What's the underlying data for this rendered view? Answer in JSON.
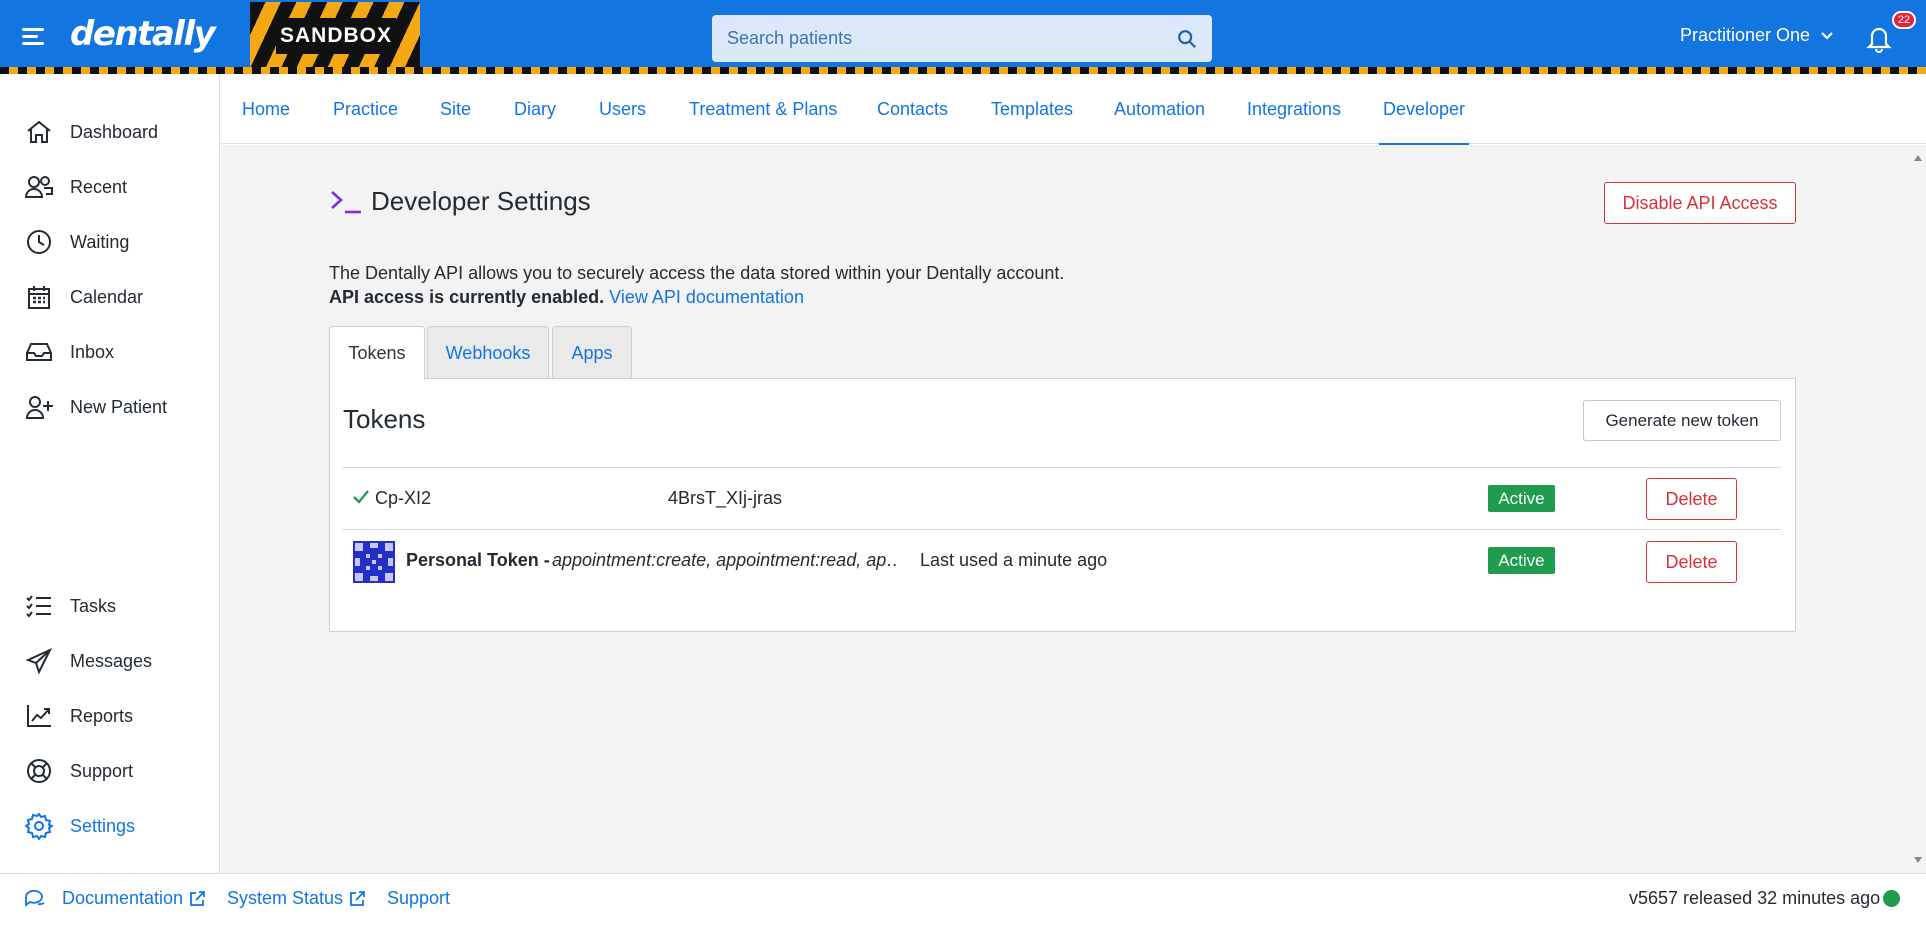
{
  "header": {
    "logo": "dentally",
    "environment_label": "SANDBOX",
    "search_placeholder": "Search patients",
    "user_name": "Practitioner One",
    "notification_count": "22"
  },
  "sidebar": {
    "items": [
      {
        "label": "Dashboard",
        "icon": "home-icon"
      },
      {
        "label": "Recent",
        "icon": "users-icon"
      },
      {
        "label": "Waiting",
        "icon": "clock-icon"
      },
      {
        "label": "Calendar",
        "icon": "calendar-icon"
      },
      {
        "label": "Inbox",
        "icon": "inbox-icon"
      },
      {
        "label": "New Patient",
        "icon": "user-plus-icon"
      },
      {
        "label": "Tasks",
        "icon": "tasks-icon"
      },
      {
        "label": "Messages",
        "icon": "paper-plane-icon"
      },
      {
        "label": "Reports",
        "icon": "chart-line-icon"
      },
      {
        "label": "Support",
        "icon": "lifebuoy-icon"
      },
      {
        "label": "Settings",
        "icon": "gear-icon",
        "active": true
      }
    ]
  },
  "subnav": {
    "items": [
      "Home",
      "Practice",
      "Site",
      "Diary",
      "Users",
      "Treatment & Plans",
      "Contacts",
      "Templates",
      "Automation",
      "Integrations",
      "Developer"
    ],
    "active": "Developer"
  },
  "developer": {
    "title": "Developer Settings",
    "disable_button": "Disable API Access",
    "description": "The Dentally API allows you to securely access the data stored within your Dentally account.",
    "status_text": "API access is currently enabled.",
    "doc_link": "View API documentation",
    "tabs": [
      "Tokens",
      "Webhooks",
      "Apps"
    ],
    "active_tab": "Tokens"
  },
  "tokens": {
    "title": "Tokens",
    "generate_button": "Generate new token",
    "rows": [
      {
        "token_start": "Cp-XI2",
        "token_end": "4BrsT_XIj-jras",
        "status": "Active",
        "delete_label": "Delete"
      },
      {
        "name": "Personal Token -",
        "scopes": "appointment:create, appointment:read, ap…",
        "last_used": "Last used a minute ago",
        "status": "Active",
        "delete_label": "Delete"
      }
    ]
  },
  "footer": {
    "documentation": "Documentation",
    "system_status": "System Status",
    "support": "Support",
    "version": "v5657 released 32 minutes ago"
  },
  "colors": {
    "brand_blue": "#1275e0",
    "link_blue": "#1376e0",
    "danger": "#d3343b",
    "success": "#1f9c4e",
    "hazard_yellow": "#f4a814"
  }
}
